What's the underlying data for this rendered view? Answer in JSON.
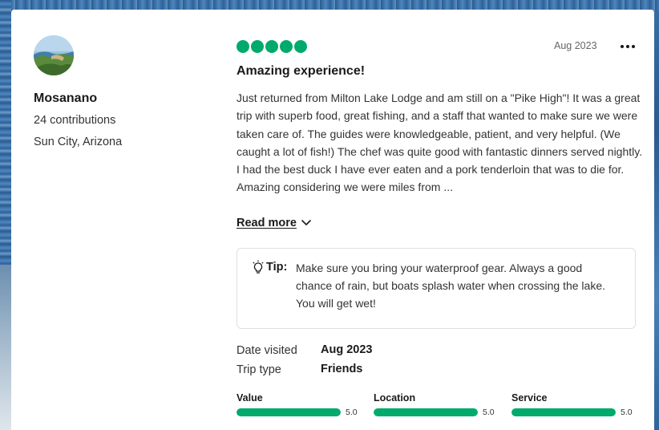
{
  "reviewer": {
    "name": "Mosanano",
    "contributions": "24 contributions",
    "location": "Sun City, Arizona"
  },
  "review": {
    "rating": 5,
    "rating_max": 5,
    "date": "Aug 2023",
    "title": "Amazing experience!",
    "body": "Just returned from Milton Lake Lodge and am still on a \"Pike High\"! It was a great trip with superb food, great fishing, and a staff that wanted to make sure we were taken care of.  The guides were knowledgeable, patient, and very helpful.  (We caught a lot of fish!) The chef was quite good with fantastic dinners served nightly.  I had the best duck I have ever eaten and a pork tenderloin that was to die for.  Amazing considering we were miles from ...",
    "read_more_label": "Read more"
  },
  "tip": {
    "label": "Tip:",
    "text": "Make sure you bring your waterproof gear. Always a good chance of rain, but boats splash water when crossing the lake. You will get wet!"
  },
  "meta": {
    "date_visited_label": "Date visited",
    "date_visited_value": "Aug 2023",
    "trip_type_label": "Trip type",
    "trip_type_value": "Friends"
  },
  "sub_ratings": [
    {
      "label": "Value",
      "value": "5.0",
      "fraction": 1.0
    },
    {
      "label": "Location",
      "value": "5.0",
      "fraction": 1.0
    },
    {
      "label": "Service",
      "value": "5.0",
      "fraction": 1.0
    }
  ],
  "colors": {
    "accent_green": "#00aa6c",
    "card_background": "#ffffff",
    "background_water": "#3b74ab"
  },
  "icons": {
    "more": "more-horizontal-icon",
    "read_more": "chevron-down-icon",
    "tip": "lightbulb-icon"
  }
}
